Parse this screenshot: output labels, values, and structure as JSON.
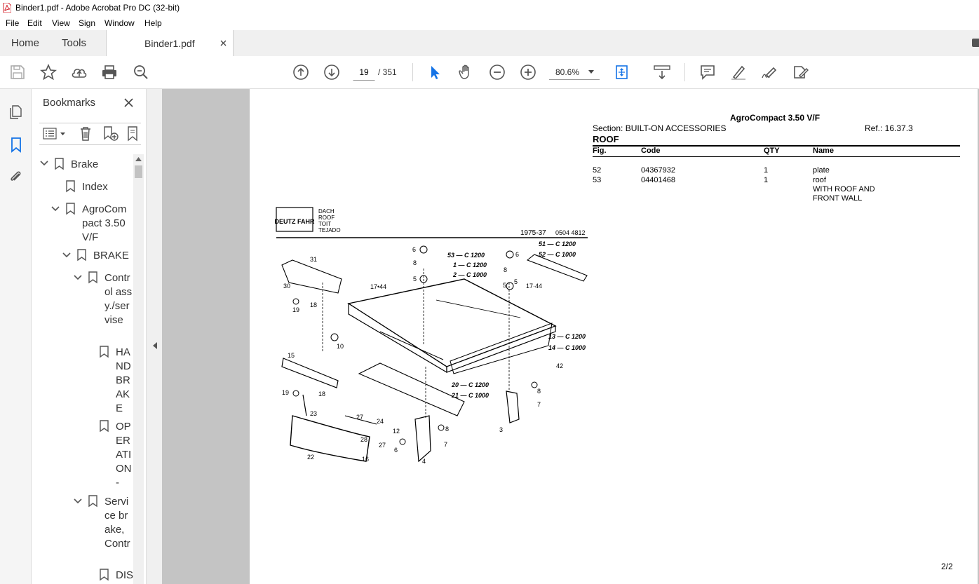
{
  "window": {
    "title": "Binder1.pdf - Adobe Acrobat Pro DC (32-bit)"
  },
  "menu": [
    "File",
    "Edit",
    "View",
    "Sign",
    "Window",
    "Help"
  ],
  "tabs": {
    "home": "Home",
    "tools": "Tools",
    "document": "Binder1.pdf"
  },
  "toolbar": {
    "page_current": "19",
    "page_total": "/ 351",
    "zoom": "80.6%"
  },
  "bookmarks": {
    "title": "Bookmarks",
    "items": [
      {
        "label": "Brake"
      },
      {
        "label": "Index"
      },
      {
        "label": "AgroCompact 3.50 V/F"
      },
      {
        "label": "BRAKE"
      },
      {
        "label": "Control assy./servise"
      },
      {
        "label": "HANDBRAKE"
      },
      {
        "label": "OPERATION -"
      },
      {
        "label": "Service brake, Contr"
      },
      {
        "label": "DIS"
      }
    ]
  },
  "pdf": {
    "model": "AgroCompact 3.50 V/F",
    "section": "Section: BUILT-ON ACCESSORIES",
    "ref": "Ref.: 16.37.3",
    "heading": "ROOF",
    "columns": [
      "Fig.",
      "Code",
      "QTY",
      "Name"
    ],
    "rows": [
      {
        "fig": "52",
        "code": "04367932",
        "qty": "1",
        "name": "plate",
        "extra": ""
      },
      {
        "fig": "53",
        "code": "04401468",
        "qty": "1",
        "name": "roof",
        "extra": "WITH ROOF AND",
        "extra2": "FRONT WALL"
      }
    ],
    "page_number": "2/2",
    "drawing": {
      "brand": "DEUTZ FAHR",
      "langs": [
        "DACH",
        "ROOF",
        "TOIT",
        "TEJADO"
      ],
      "code": "1975-37",
      "code2": "0504 4812",
      "labels": [
        "51 — C 1200",
        "52 — C 1000",
        "53 — C 1200",
        "1 — C 1200",
        "2 — C 1000",
        "13 — C 1200",
        "14 — C 1000",
        "20 — C 1200",
        "21 — C 1000"
      ],
      "numbers": [
        "31",
        "30",
        "19",
        "18",
        "6",
        "8",
        "5",
        "17•44",
        "10",
        "15",
        "19",
        "18",
        "23",
        "22",
        "27",
        "24",
        "28",
        "27",
        "12",
        "6",
        "16",
        "8",
        "7",
        "4",
        "3",
        "8",
        "7",
        "42",
        "6",
        "8",
        "5",
        "17·44",
        "5"
      ]
    }
  }
}
